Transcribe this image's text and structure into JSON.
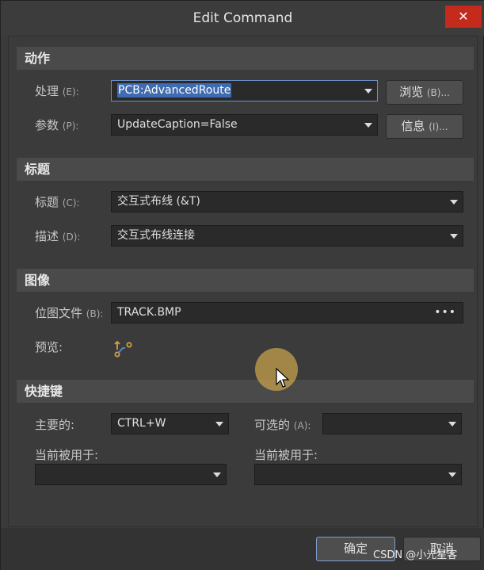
{
  "window": {
    "title": "Edit Command",
    "close_glyph": "✕"
  },
  "sections": {
    "action": "动作",
    "caption": "标题",
    "image": "图像",
    "shortcut": "快捷键"
  },
  "action": {
    "process_label": "处理",
    "process_acc": "(E):",
    "process_value": "PCB:AdvancedRoute",
    "params_label": "参数",
    "params_acc": "(P):",
    "params_value": "UpdateCaption=False",
    "browse_label": "浏览",
    "browse_acc": "(B)...",
    "info_label": "信息",
    "info_acc": "(I)..."
  },
  "caption": {
    "caption_label": "标题",
    "caption_acc": "(C):",
    "caption_value": "交互式布线 (&T)",
    "desc_label": "描述",
    "desc_acc": "(D):",
    "desc_value": "交互式布线连接"
  },
  "image": {
    "bitmap_label": "位图文件",
    "bitmap_acc": "(B):",
    "bitmap_value": "TRACK.BMP",
    "bitmap_more": "•••",
    "preview_label": "预览:",
    "preview_icon": "route-track-icon"
  },
  "shortcut": {
    "primary_label": "主要的:",
    "primary_value": "CTRL+W",
    "alternate_label": "可选的",
    "alternate_acc": "(A):",
    "alternate_value": "",
    "used_by_left": "当前被用于:",
    "used_by_left_value": "",
    "used_by_right": "当前被用于:",
    "used_by_right_value": ""
  },
  "footer": {
    "ok_label": "确定",
    "cancel_label": "取消"
  },
  "watermark": "CSDN @小光星客",
  "colors": {
    "accent": "#3f6bb0",
    "close": "#c42b1c",
    "icon": "#d6a23a"
  }
}
